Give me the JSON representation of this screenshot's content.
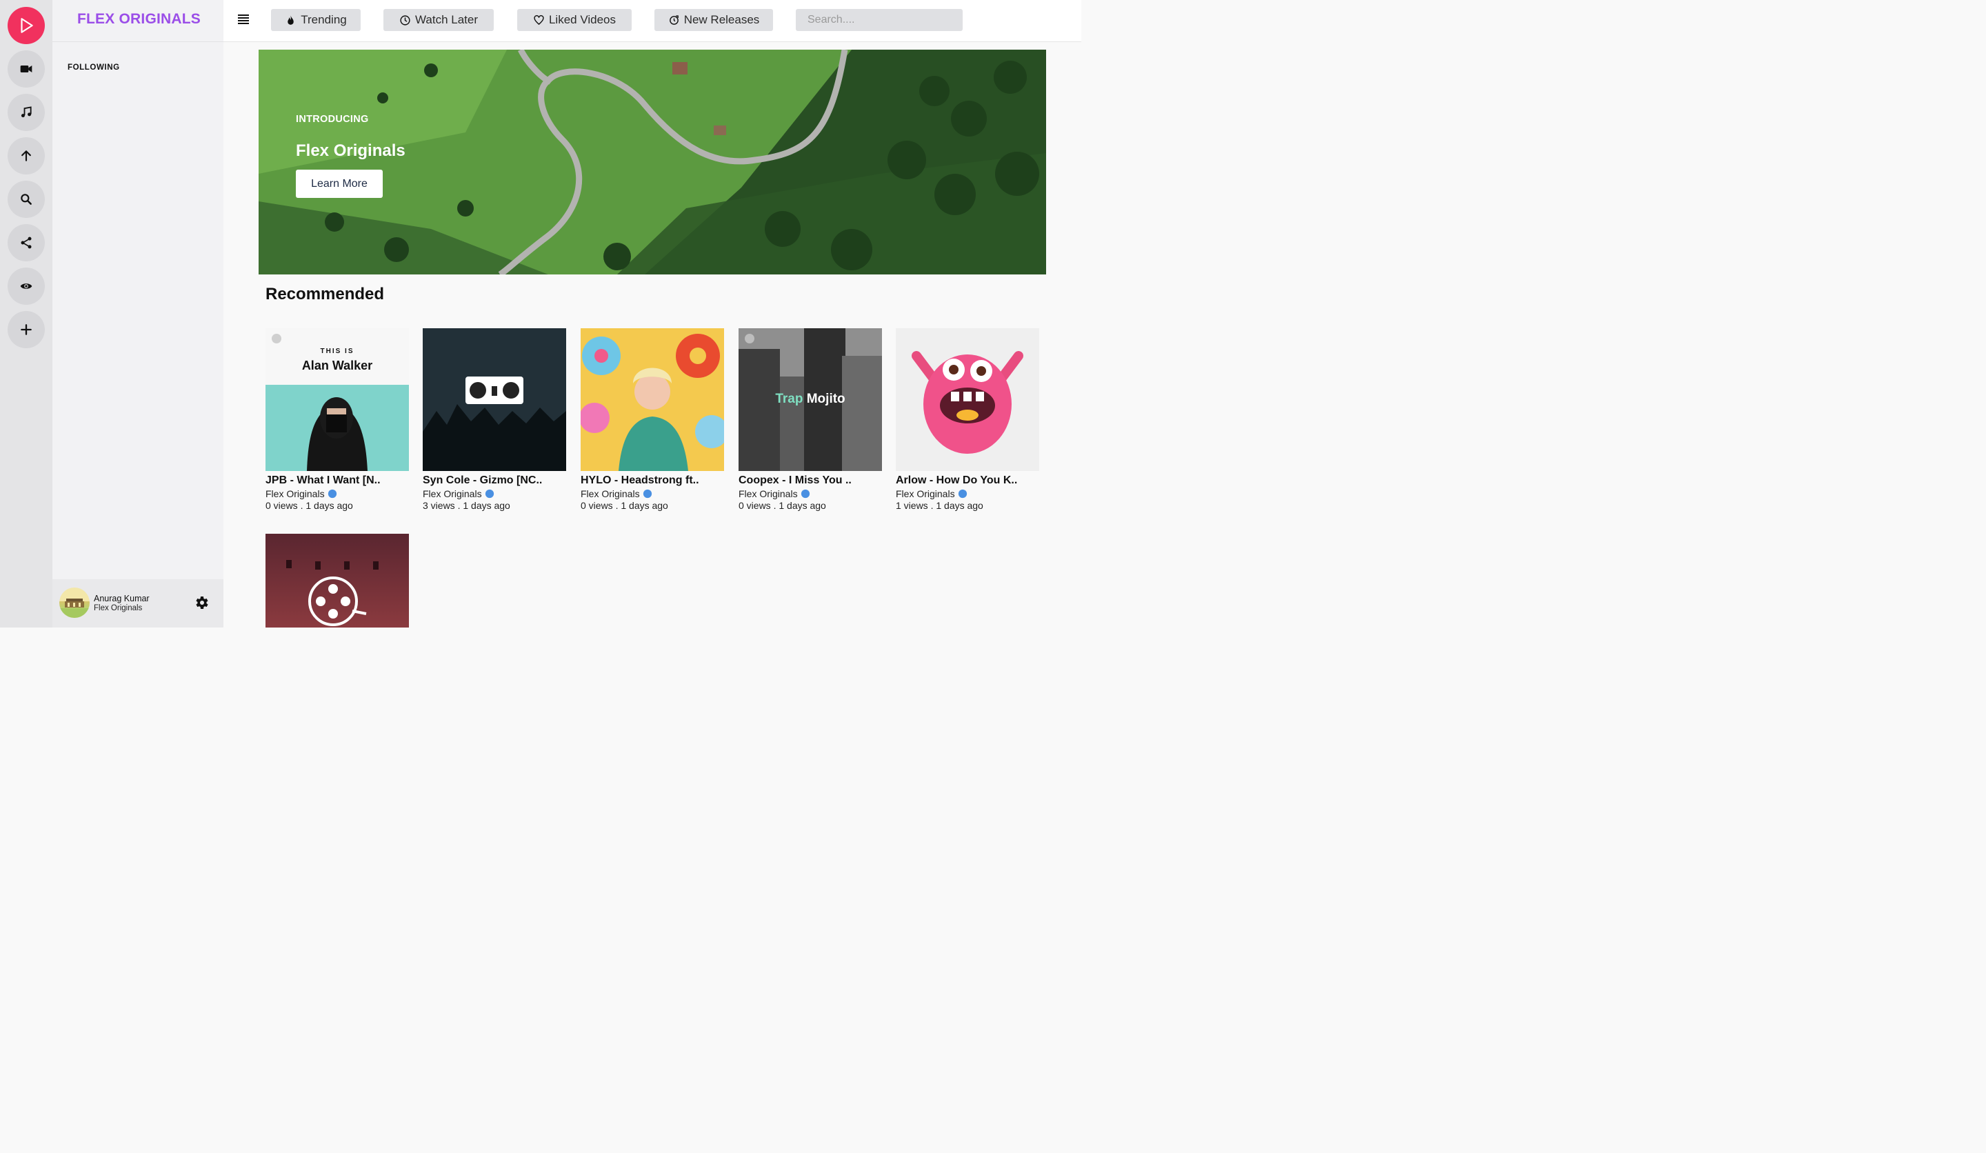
{
  "brand": "FLEX ORIGINALS",
  "sidebar": {
    "section_label": "FOLLOWING"
  },
  "user": {
    "name": "Anurag Kumar",
    "channel": "Flex Originals"
  },
  "rail": {
    "items": [
      "play-logo-icon",
      "video-camera-icon",
      "music-note-icon",
      "upload-arrow-icon",
      "search-icon",
      "share-icon",
      "eye-icon",
      "plus-icon"
    ]
  },
  "nav": {
    "trending": "Trending",
    "watch_later": "Watch Later",
    "liked_videos": "Liked Videos",
    "new_releases": "New Releases"
  },
  "search": {
    "placeholder": "Search...."
  },
  "hero": {
    "label": "INTRODUCING",
    "title": "Flex Originals",
    "button": "Learn More"
  },
  "recommended": {
    "title": "Recommended",
    "videos": [
      {
        "title": "JPB - What I Want [N..",
        "channel": "Flex Originals",
        "meta": "0 views . 1 days ago",
        "thumb_text_small": "THIS IS",
        "thumb_text_big": "Alan Walker"
      },
      {
        "title": "Syn Cole - Gizmo [NC..",
        "channel": "Flex Originals",
        "meta": "3 views . 1 days ago"
      },
      {
        "title": "HYLO - Headstrong ft..",
        "channel": "Flex Originals",
        "meta": "0 views . 1 days ago"
      },
      {
        "title": "Coopex - I Miss You ..",
        "channel": "Flex Originals",
        "meta": "0 views . 1 days ago",
        "thumb_text_a": "Trap",
        "thumb_text_b": " Mojito"
      },
      {
        "title": "Arlow - How Do You K..",
        "channel": "Flex Originals",
        "meta": "1 views . 1 days ago"
      }
    ]
  },
  "colors": {
    "accent": "#9b4ee8",
    "logo": "#f1315e",
    "verified": "#4a90e2"
  }
}
